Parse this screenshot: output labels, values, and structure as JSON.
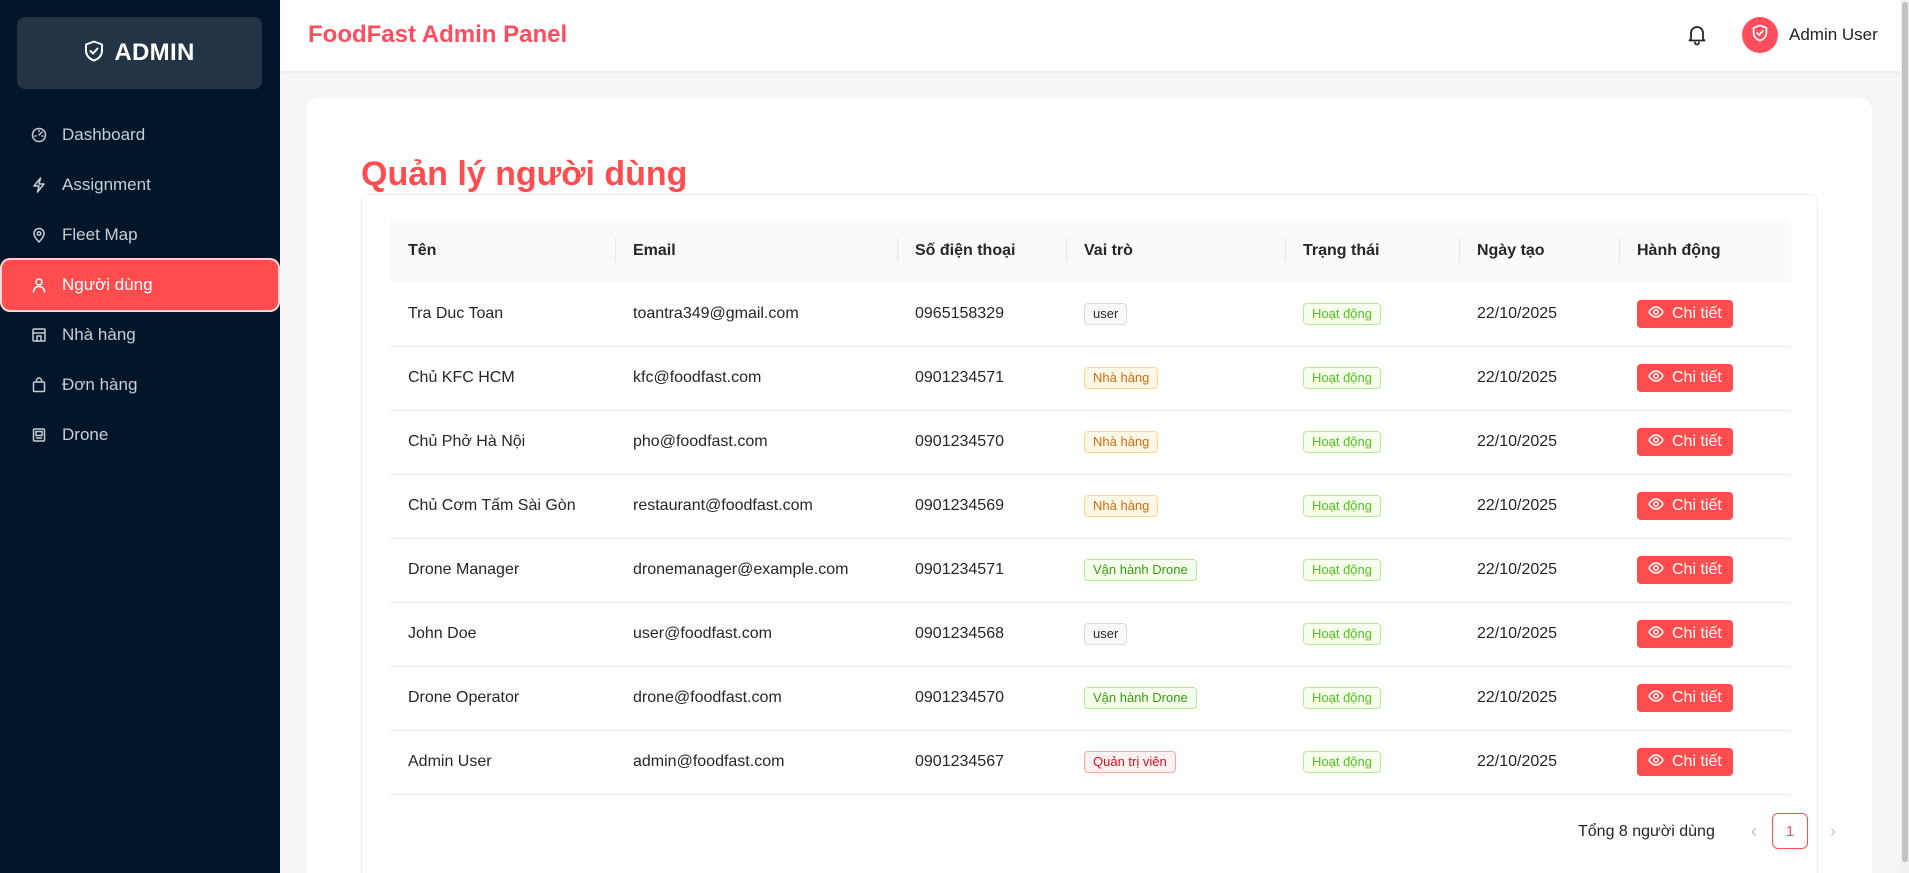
{
  "sidebar": {
    "brand": "ADMIN",
    "items": [
      {
        "label": "Dashboard",
        "icon": "dashboard-icon"
      },
      {
        "label": "Assignment",
        "icon": "lightning-icon"
      },
      {
        "label": "Fleet Map",
        "icon": "map-pin-icon"
      },
      {
        "label": "Người dùng",
        "icon": "user-icon",
        "active": true
      },
      {
        "label": "Nhà hàng",
        "icon": "shop-icon"
      },
      {
        "label": "Đơn hàng",
        "icon": "shopping-bag-icon"
      },
      {
        "label": "Drone",
        "icon": "drone-icon"
      }
    ]
  },
  "header": {
    "title": "FoodFast Admin Panel",
    "user_name": "Admin User"
  },
  "main": {
    "title": "Quản lý người dùng",
    "columns": [
      "Tên",
      "Email",
      "Số điện thoại",
      "Vai trò",
      "Trạng thái",
      "Ngày tạo",
      "Hành động"
    ],
    "rows": [
      {
        "name": "Tra Duc Toan",
        "email": "toantra349@gmail.com",
        "phone": "0965158329",
        "role": "user",
        "role_type": "user",
        "status": "Hoạt động",
        "created": "22/10/2025",
        "action": "Chi tiết"
      },
      {
        "name": "Chủ KFC HCM",
        "email": "kfc@foodfast.com",
        "phone": "0901234571",
        "role": "Nhà hàng",
        "role_type": "restaurant",
        "status": "Hoạt động",
        "created": "22/10/2025",
        "action": "Chi tiết"
      },
      {
        "name": "Chủ Phở Hà Nội",
        "email": "pho@foodfast.com",
        "phone": "0901234570",
        "role": "Nhà hàng",
        "role_type": "restaurant",
        "status": "Hoạt động",
        "created": "22/10/2025",
        "action": "Chi tiết"
      },
      {
        "name": "Chủ Cơm Tấm Sài Gòn",
        "email": "restaurant@foodfast.com",
        "phone": "0901234569",
        "role": "Nhà hàng",
        "role_type": "restaurant",
        "status": "Hoạt động",
        "created": "22/10/2025",
        "action": "Chi tiết"
      },
      {
        "name": "Drone Manager",
        "email": "dronemanager@example.com",
        "phone": "0901234571",
        "role": "Vận hành Drone",
        "role_type": "drone",
        "status": "Hoạt động",
        "created": "22/10/2025",
        "action": "Chi tiết"
      },
      {
        "name": "John Doe",
        "email": "user@foodfast.com",
        "phone": "0901234568",
        "role": "user",
        "role_type": "user",
        "status": "Hoạt động",
        "created": "22/10/2025",
        "action": "Chi tiết"
      },
      {
        "name": "Drone Operator",
        "email": "drone@foodfast.com",
        "phone": "0901234570",
        "role": "Vận hành Drone",
        "role_type": "drone",
        "status": "Hoạt động",
        "created": "22/10/2025",
        "action": "Chi tiết"
      },
      {
        "name": "Admin User",
        "email": "admin@foodfast.com",
        "phone": "0901234567",
        "role": "Quản trị viên",
        "role_type": "admin",
        "status": "Hoạt động",
        "created": "22/10/2025",
        "action": "Chi tiết"
      }
    ]
  },
  "pagination": {
    "total": "Tổng 8 người dùng",
    "current_page": "1"
  },
  "colors": {
    "accent": "#ff4d4f",
    "sidebar_bg": "#021529"
  }
}
